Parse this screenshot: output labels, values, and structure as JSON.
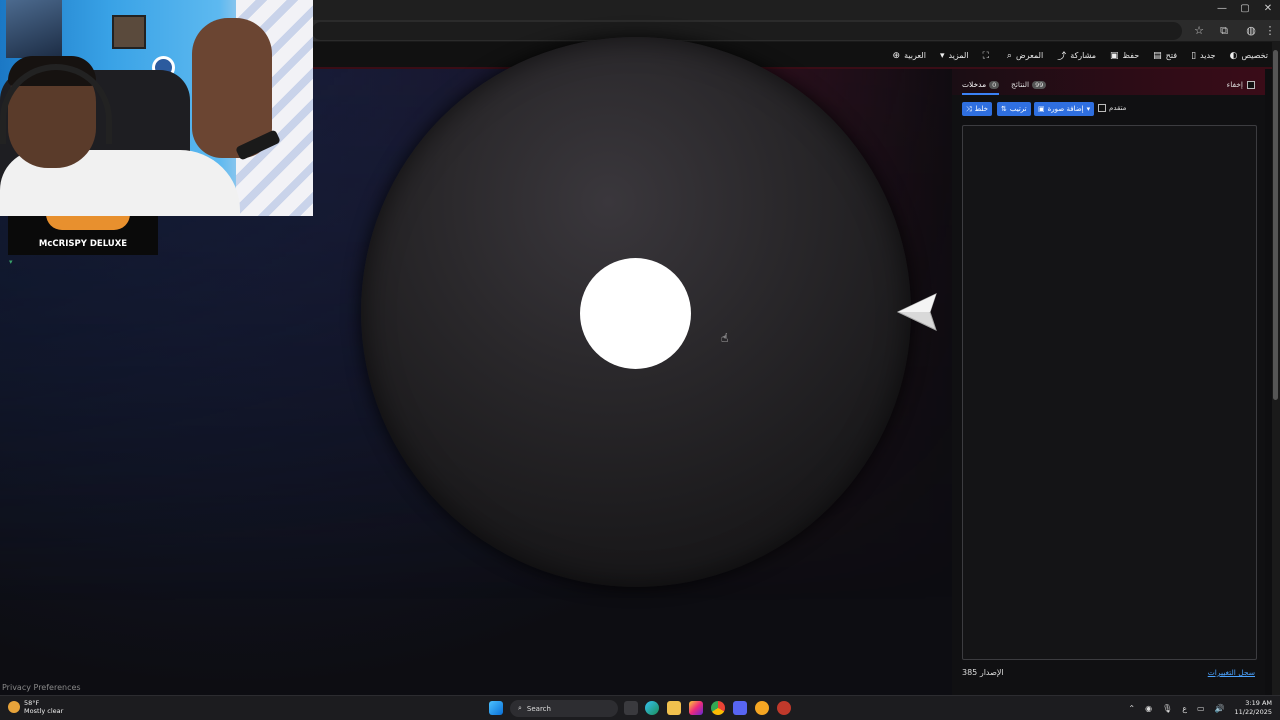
{
  "browser": {
    "window_controls": [
      "—",
      "▢",
      "✕"
    ],
    "addr_icons": [
      "star-icon",
      "extensions-icon",
      "profile-icon",
      "menu-icon"
    ]
  },
  "appbar": {
    "items": [
      {
        "label": "العربية",
        "icon": "globe-icon",
        "glyph": "⊕"
      },
      {
        "label": "المزيد",
        "icon": "caret-down-icon",
        "glyph": "▾"
      },
      {
        "label": "",
        "icon": "fullscreen-icon",
        "glyph": "⛶"
      },
      {
        "label": "المعرض",
        "icon": "search-icon",
        "glyph": "⌕"
      },
      {
        "label": "مشاركة",
        "icon": "share-icon",
        "glyph": "⤴"
      },
      {
        "label": "حفظ",
        "icon": "save-icon",
        "glyph": "▣"
      },
      {
        "label": "فتح",
        "icon": "folder-icon",
        "glyph": "▤"
      },
      {
        "label": "جديد",
        "icon": "new-file-icon",
        "glyph": "▯"
      },
      {
        "label": "تخصيص",
        "icon": "palette-icon",
        "glyph": "◐"
      }
    ]
  },
  "overlay": {
    "ad_text": "McCRISPY DELUXE",
    "privacy": "Privacy Preferences"
  },
  "panel": {
    "hide_label": "إخفاء",
    "tabs": [
      {
        "label": "مدخلات",
        "badge": "0",
        "active": true
      },
      {
        "label": "النتائج",
        "badge": "99",
        "active": false
      }
    ],
    "controls": {
      "shuffle": "خلط",
      "sort": "ترتيب",
      "add_image": "إضافة صورة",
      "advanced": "متقدم"
    },
    "version_label": "الإصدار",
    "version_number": "385",
    "changelog_link": "سجل التغييرات"
  },
  "taskbar": {
    "weather_temp": "58°F",
    "weather_desc": "Mostly clear",
    "search_label": "Search",
    "lang": "ع",
    "time": "3:19 AM",
    "date": "11/22/2025"
  },
  "colors": {
    "accent_blue": "#2f6fe0",
    "link_blue": "#4aa3ff",
    "header_red": "#3a0c18"
  }
}
